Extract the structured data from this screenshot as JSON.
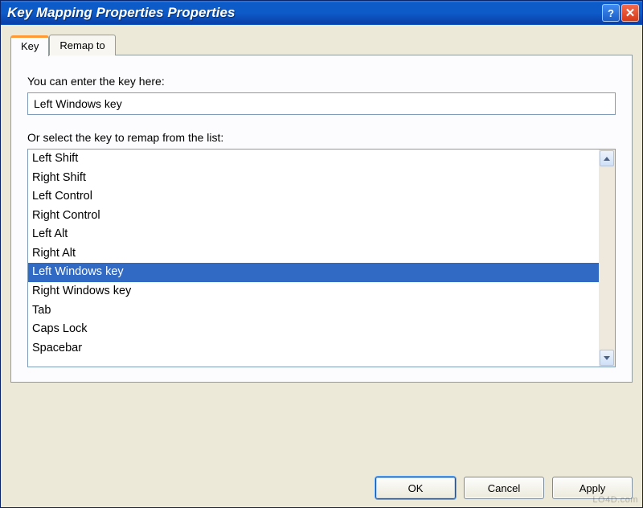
{
  "window": {
    "title": "Key Mapping Properties Properties"
  },
  "tabs": [
    {
      "label": "Key",
      "active": true
    },
    {
      "label": "Remap to",
      "active": false
    }
  ],
  "panel": {
    "inputLabel": "You can enter the key here:",
    "inputValue": "Left Windows key",
    "listLabel": "Or select the key to remap from the list:",
    "items": [
      "Left Shift",
      "Right Shift",
      "Left Control",
      "Right Control",
      "Left Alt",
      "Right Alt",
      "Left Windows key",
      "Right Windows key",
      "Tab",
      "Caps Lock",
      "Spacebar"
    ],
    "selectedIndex": 6
  },
  "buttons": {
    "ok": "OK",
    "cancel": "Cancel",
    "apply": "Apply"
  },
  "watermark": "LO4D.com"
}
